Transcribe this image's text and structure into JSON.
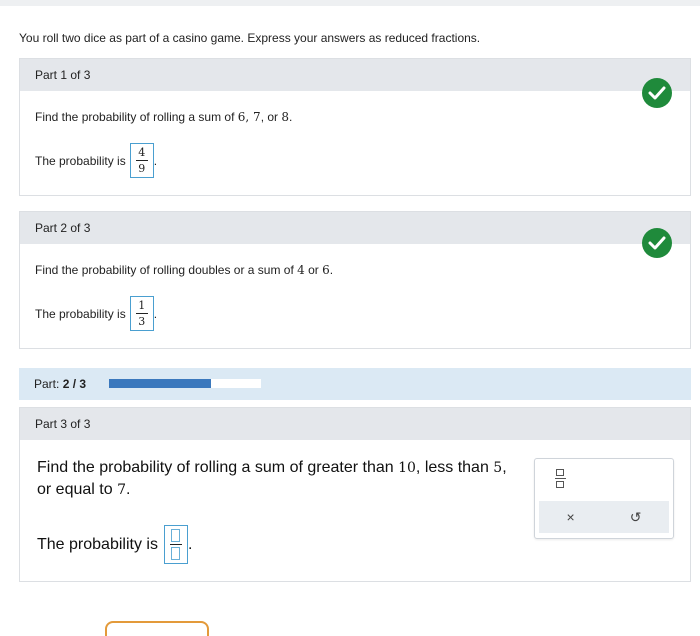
{
  "intro": "You roll two dice as part of a casino game. Express your answers as reduced fractions.",
  "part1": {
    "header": "Part 1 of 3",
    "question_prefix": "Find the probability of rolling a sum of ",
    "question_math": "6, 7",
    "question_mid": ", or ",
    "question_math2": "8",
    "question_suffix": ".",
    "answer_label": "The probability is",
    "numerator": "4",
    "denominator": "9",
    "period": "."
  },
  "part2": {
    "header": "Part 2 of 3",
    "question_prefix": "Find the probability of rolling doubles or a sum of ",
    "question_math": "4",
    "question_mid": " or ",
    "question_math2": "6",
    "question_suffix": ".",
    "answer_label": "The probability is",
    "numerator": "1",
    "denominator": "3",
    "period": "."
  },
  "progress": {
    "label": "Part:",
    "value": "2 / 3",
    "fraction": 0.67
  },
  "part3": {
    "header": "Part 3 of 3",
    "question_prefix": "Find the probability of rolling a sum of greater than ",
    "question_math": "10",
    "question_mid": ", less than ",
    "question_math2": "5",
    "question_mid2": ", or equal to ",
    "question_math3": "7",
    "question_suffix": ".",
    "answer_label": "The probability is",
    "period": "."
  },
  "tools": {
    "clear_symbol": "×",
    "undo_symbol": "↺"
  },
  "colors": {
    "check_green": "#1f8a3b",
    "progress_fill": "#3a78bd",
    "input_border": "#4a9fd0",
    "next_button_border": "#e39a3a"
  }
}
